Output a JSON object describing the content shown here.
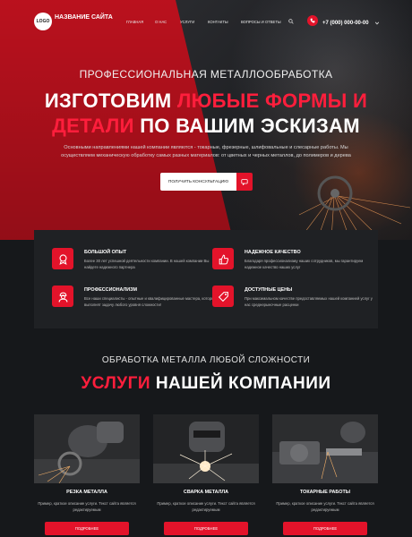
{
  "header": {
    "logo_text": "LOGO",
    "site_name": "НАЗВАНИЕ САЙТА",
    "nav": [
      "ГЛАВНАЯ",
      "О НАС",
      "УСЛУГИ",
      "КОНТАКТЫ",
      "ВОПРОСЫ И ОТВЕТЫ"
    ],
    "phone": "+7 (000) 000-00-00"
  },
  "hero": {
    "subtitle": "ПРОФЕССИОНАЛЬНАЯ МЕТАЛЛООБРАБОТКА",
    "title_a": "ИЗГОТОВИМ",
    "title_b": "ЛЮБЫЕ ФОРМЫ И",
    "title_c": "ДЕТАЛИ",
    "title_d": "ПО ВАШИМ ЭСКИЗАМ",
    "desc_1": "Основными направлениями нашей компании являются - токарные, фрезерные, шлифовальные и слесарные работы. Мы",
    "desc_2": "осуществляем механическую обработку самых разных материалов: от цветных и черных металлов, до полимеров и дерева",
    "cta": "ПОЛУЧИТЬ КОНСУЛЬТАЦИЮ"
  },
  "features": [
    {
      "title": "БОЛЬШОЙ ОПЫТ",
      "text": "Более 30 лет успешной деятельности компании. В нашей компании Вы найдете надежного партнера",
      "icon": "award-icon"
    },
    {
      "title": "НАДЕЖНОЕ КАЧЕСТВО",
      "text": "Благодаря профессионализму наших сотрудников, мы гарантируем надежное качество наших услуг",
      "icon": "quality-icon"
    },
    {
      "title": "ПРОФЕССИОНАЛИЗМ",
      "text": "Все наши специалисты - опытные и квалифицированные мастера, которые выполнят задачу любого уровня сложности!",
      "icon": "worker-icon"
    },
    {
      "title": "ДОСТУПНЫЕ ЦЕНЫ",
      "text": "При максимальном качестве предоставляемых нашей компанией услуг у нас среднерыночные расценки",
      "icon": "price-icon"
    }
  ],
  "services": {
    "subtitle": "ОБРАБОТКА МЕТАЛЛА ЛЮБОЙ СЛОЖНОСТИ",
    "title_red": "УСЛУГИ",
    "title_white": "НАШЕЙ КОМПАНИИ",
    "items": [
      {
        "name": "РЕЗКА МЕТАЛЛА",
        "text": "Пример, краткое описание услуги. Текст сайта является редактируемым",
        "button": "ПОДРОБНЕЕ"
      },
      {
        "name": "СВАРКА МЕТАЛЛА",
        "text": "Пример, краткое описание услуги. Текст сайта является редактируемым",
        "button": "ПОДРОБНЕЕ"
      },
      {
        "name": "ТОКАРНЫЕ РАБОТЫ",
        "text": "Пример, краткое описание услуги. Текст сайта является редактируемым",
        "button": "ПОДРОБНЕЕ"
      }
    ]
  },
  "colors": {
    "accent": "#e3132a",
    "background": "#16181b",
    "panel": "#1f2124"
  }
}
